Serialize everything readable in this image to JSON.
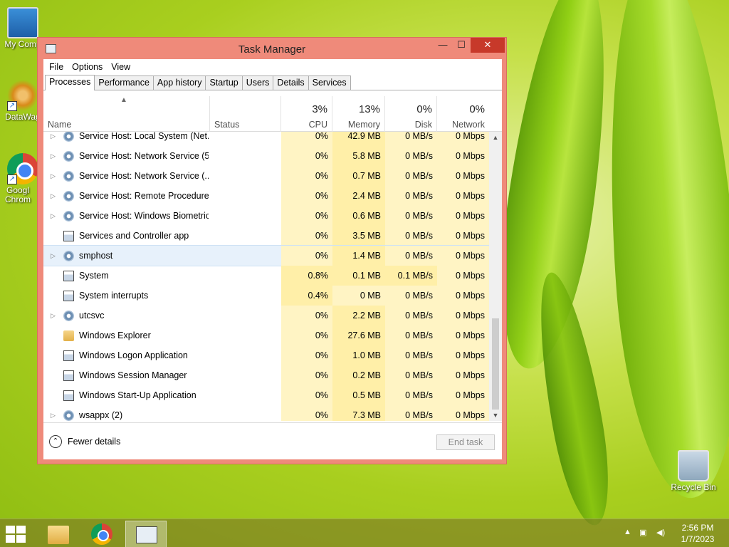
{
  "desktop": {
    "icons": [
      {
        "label": "My Comp"
      },
      {
        "label": "DataWag"
      },
      {
        "label": "Googl Chrom"
      },
      {
        "label": "Recycle Bin"
      }
    ]
  },
  "window": {
    "title": "Task Manager",
    "controls": {
      "minimize": "—",
      "maximize": "☐",
      "close": "✕"
    },
    "menu": [
      "File",
      "Options",
      "View"
    ],
    "tabs": [
      "Processes",
      "Performance",
      "App history",
      "Startup",
      "Users",
      "Details",
      "Services"
    ],
    "active_tab": "Processes",
    "columns": {
      "name": {
        "label": "Name"
      },
      "status": {
        "label": "Status"
      },
      "cpu": {
        "label": "CPU",
        "percent": "3%"
      },
      "memory": {
        "label": "Memory",
        "percent": "13%"
      },
      "disk": {
        "label": "Disk",
        "percent": "0%"
      },
      "network": {
        "label": "Network",
        "percent": "0%"
      }
    },
    "sort_indicator": "▲",
    "processes": [
      {
        "name": "Service Host: Local System (Net...",
        "expandable": true,
        "icon": "gear-icon",
        "cpu": "0%",
        "memory": "42.9 MB",
        "disk": "0 MB/s",
        "network": "0 Mbps",
        "partial": true
      },
      {
        "name": "Service Host: Network Service (5)",
        "expandable": true,
        "icon": "gear-icon",
        "cpu": "0%",
        "memory": "5.8 MB",
        "disk": "0 MB/s",
        "network": "0 Mbps"
      },
      {
        "name": "Service Host: Network Service (...",
        "expandable": true,
        "icon": "gear-icon",
        "cpu": "0%",
        "memory": "0.7 MB",
        "disk": "0 MB/s",
        "network": "0 Mbps"
      },
      {
        "name": "Service Host: Remote Procedure...",
        "expandable": true,
        "icon": "gear-icon",
        "cpu": "0%",
        "memory": "2.4 MB",
        "disk": "0 MB/s",
        "network": "0 Mbps"
      },
      {
        "name": "Service Host: Windows Biometric",
        "expandable": true,
        "icon": "gear-icon",
        "cpu": "0%",
        "memory": "0.6 MB",
        "disk": "0 MB/s",
        "network": "0 Mbps"
      },
      {
        "name": "Services and Controller app",
        "expandable": false,
        "icon": "app-window-icon",
        "cpu": "0%",
        "memory": "3.5 MB",
        "disk": "0 MB/s",
        "network": "0 Mbps"
      },
      {
        "name": "smphost",
        "expandable": true,
        "icon": "gear-icon",
        "cpu": "0%",
        "memory": "1.4 MB",
        "disk": "0 MB/s",
        "network": "0 Mbps",
        "selected": true
      },
      {
        "name": "System",
        "expandable": false,
        "icon": "app-window-icon",
        "cpu": "0.8%",
        "memory": "0.1 MB",
        "disk": "0.1 MB/s",
        "network": "0 Mbps"
      },
      {
        "name": "System interrupts",
        "expandable": false,
        "icon": "app-window-icon",
        "cpu": "0.4%",
        "memory": "0 MB",
        "disk": "0 MB/s",
        "network": "0 Mbps"
      },
      {
        "name": "utcsvc",
        "expandable": true,
        "icon": "gear-icon",
        "cpu": "0%",
        "memory": "2.2 MB",
        "disk": "0 MB/s",
        "network": "0 Mbps"
      },
      {
        "name": "Windows Explorer",
        "expandable": false,
        "icon": "folder-icon",
        "cpu": "0%",
        "memory": "27.6 MB",
        "disk": "0 MB/s",
        "network": "0 Mbps"
      },
      {
        "name": "Windows Logon Application",
        "expandable": false,
        "icon": "app-window-icon",
        "cpu": "0%",
        "memory": "1.0 MB",
        "disk": "0 MB/s",
        "network": "0 Mbps"
      },
      {
        "name": "Windows Session Manager",
        "expandable": false,
        "icon": "app-window-icon",
        "cpu": "0%",
        "memory": "0.2 MB",
        "disk": "0 MB/s",
        "network": "0 Mbps"
      },
      {
        "name": "Windows Start-Up Application",
        "expandable": false,
        "icon": "app-window-icon",
        "cpu": "0%",
        "memory": "0.5 MB",
        "disk": "0 MB/s",
        "network": "0 Mbps"
      },
      {
        "name": "wsappx (2)",
        "expandable": true,
        "icon": "gear-icon",
        "cpu": "0%",
        "memory": "7.3 MB",
        "disk": "0 MB/s",
        "network": "0 Mbps"
      }
    ],
    "footer": {
      "fewer_details": "Fewer details",
      "end_task": "End task"
    },
    "colors": {
      "frame": "#ef8a7a",
      "close_button": "#c7392a",
      "heat_light": "#fff4c4",
      "heat_medium": "#ffefa8",
      "selection": "#e7f1fb"
    }
  },
  "taskbar": {
    "clock_time": "2:56 PM",
    "clock_date": "1/7/2023",
    "tray_icons": [
      "show-hidden-icons-icon",
      "network-icon",
      "volume-icon"
    ]
  }
}
